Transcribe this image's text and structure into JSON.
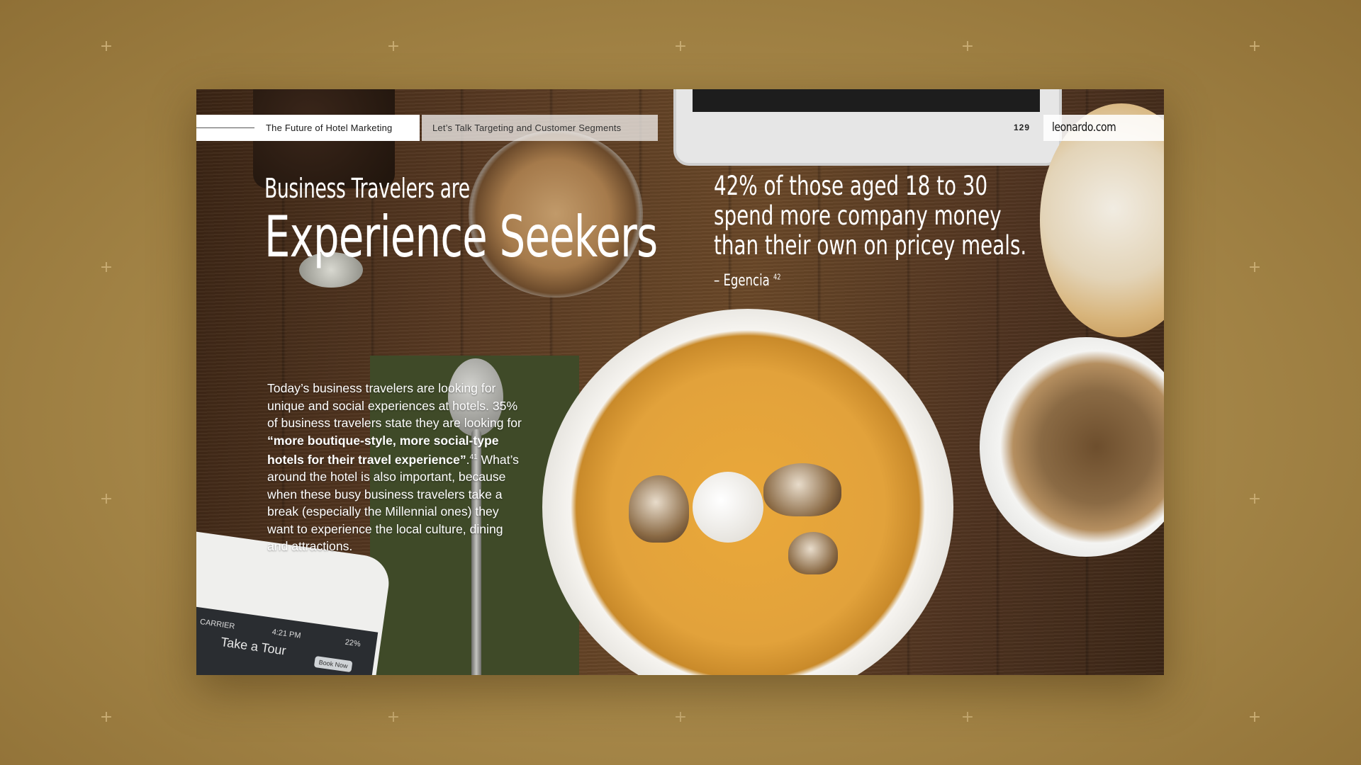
{
  "header": {
    "publication_title": "The Future of Hotel Marketing",
    "section_title": "Let’s Talk Targeting and Customer Segments",
    "page_number": "129",
    "brand": "leonardo.com"
  },
  "headline": {
    "line1": "Business Travelers are",
    "line2": "Experience Seekers"
  },
  "pull_quote": {
    "text": "42% of those aged 18 to 30 spend more company money than their own on pricey meals.",
    "source": "– Egencia",
    "source_ref": "42"
  },
  "body": {
    "part1": "Today’s business travelers are looking for unique and social experiences at hotels. 35% of business travelers state they are looking for ",
    "bold_quote": "“more boutique-style, more social-type hotels for their travel experience”",
    "after_bold": ".",
    "ref": "41",
    "part2": " What’s around the hotel is also important, because when these busy business travelers take a break (especially the Millennial ones) they want to experience the local culture, dining and attractions."
  },
  "phone": {
    "carrier": "CARRIER",
    "time": "4:21 PM",
    "battery": "22%",
    "screen_title": "Take a Tour",
    "button": "Book Now"
  },
  "colors": {
    "background": "#a8894a",
    "plus_marks": "#c9ad74",
    "header_bar": "#ffffff"
  }
}
